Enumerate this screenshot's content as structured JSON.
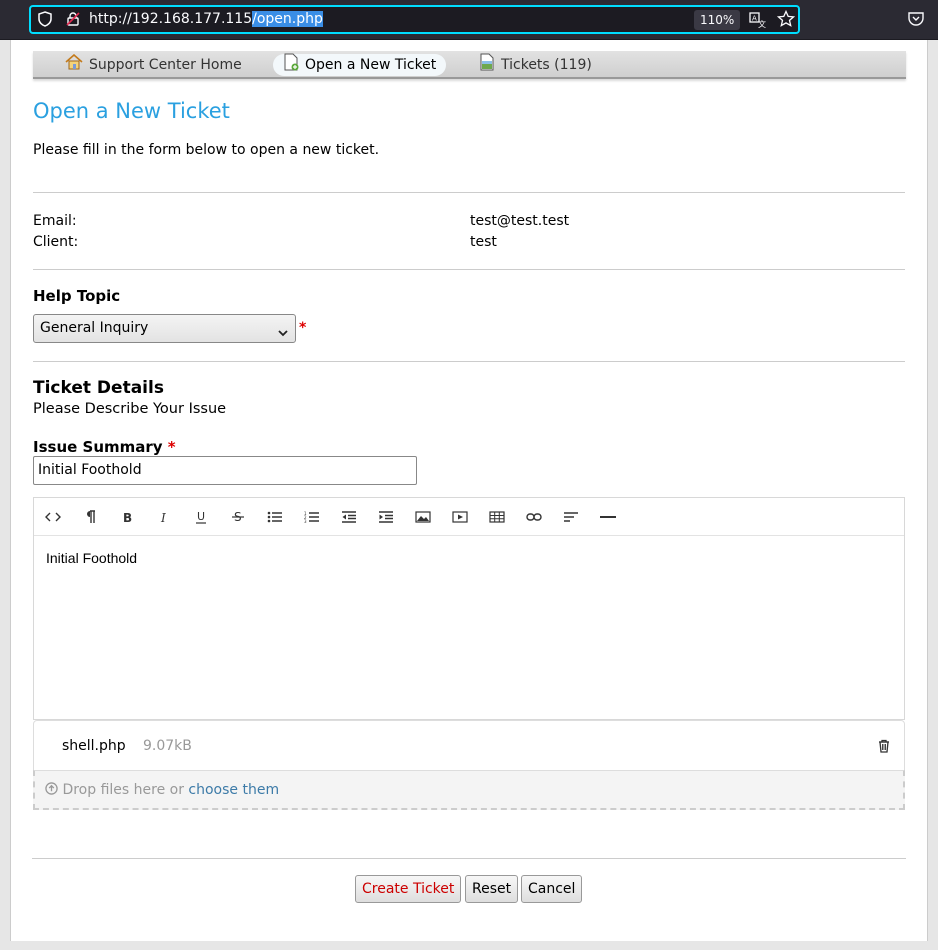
{
  "browser": {
    "url_host": "http://192.168.177.115",
    "url_path": "/open.php",
    "zoom": "110%"
  },
  "nav": {
    "items": [
      {
        "label": "Support Center Home"
      },
      {
        "label": "Open a New Ticket"
      },
      {
        "label": "Tickets (119)"
      }
    ]
  },
  "page": {
    "title": "Open a New Ticket",
    "intro": "Please fill in the form below to open a new ticket."
  },
  "user": {
    "email_label": "Email:",
    "email_value": "test@test.test",
    "client_label": "Client:",
    "client_value": "test"
  },
  "help_topic": {
    "heading": "Help Topic",
    "selected": "General Inquiry",
    "required_mark": "*"
  },
  "ticket_details": {
    "heading": "Ticket Details",
    "subheading": "Please Describe Your Issue",
    "summary_label": "Issue Summary",
    "summary_value": "Initial Foothold",
    "body_text": "Initial Foothold"
  },
  "attachments": {
    "file_name": "shell.php",
    "file_size": "9.07kB",
    "drop_text": "Drop files here or",
    "drop_link": "choose them"
  },
  "buttons": {
    "create": "Create Ticket",
    "reset": "Reset",
    "cancel": "Cancel"
  },
  "colors": {
    "title_blue": "#2aa0e0",
    "create_red": "#cc0000",
    "focus_ring": "#00ddff"
  }
}
